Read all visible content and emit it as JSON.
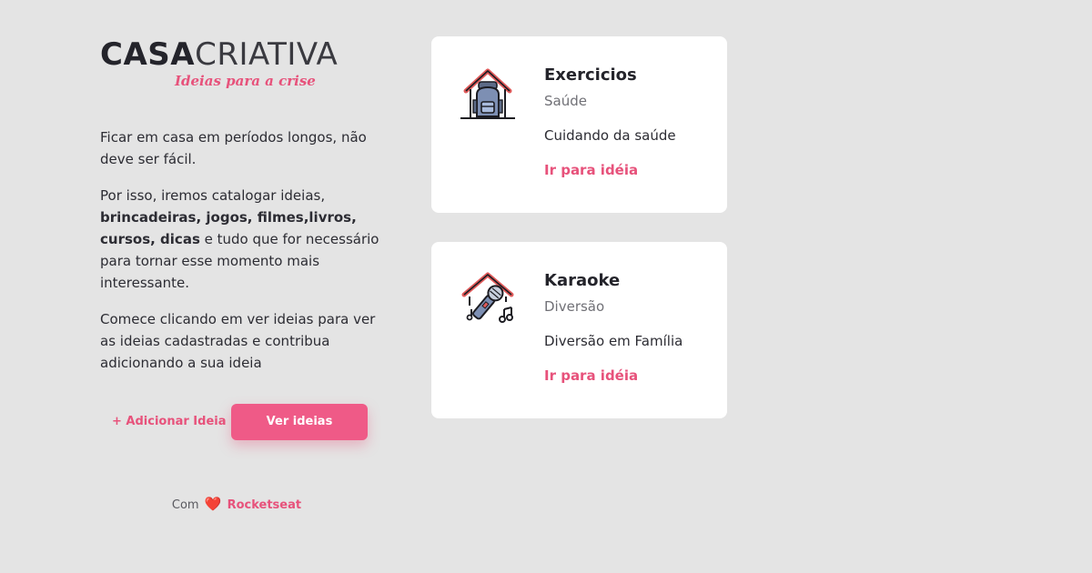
{
  "logo": {
    "part1": "CASA",
    "part2": "CRIATIVA",
    "tagline": "Ideias para a crise"
  },
  "intro": {
    "p1": "Ficar em casa em períodos longos, não deve ser fácil.",
    "p2_start": "Por isso, iremos catalogar ideias, ",
    "p2_bold": "brincadeiras, jogos, filmes,livros, cursos, dicas",
    "p2_end": " e tudo que for necessário para tornar esse momento mais interessante.",
    "p3": "Comece clicando em ver ideias para ver as ideias cadastradas e contribua adicionando a sua ideia"
  },
  "actions": {
    "add_label": "+ Adicionar Ideia",
    "view_label": "Ver ideias"
  },
  "footer": {
    "prefix": "Com",
    "heart": "❤️",
    "brand": "Rocketseat"
  },
  "ideas": [
    {
      "title": "Exercicios",
      "category": "Saúde",
      "description": "Cuidando da saúde",
      "link": "Ir para idéia",
      "icon": "house-backpack-icon"
    },
    {
      "title": "Karaoke",
      "category": "Diversão",
      "description": "Diversão em Família",
      "link": "Ir para idéia",
      "icon": "house-microphone-icon"
    }
  ],
  "colors": {
    "background": "#e4e4e4",
    "accent": "#e7527b",
    "button": "#ef5a87",
    "card": "#ffffff",
    "text": "#24242b"
  }
}
